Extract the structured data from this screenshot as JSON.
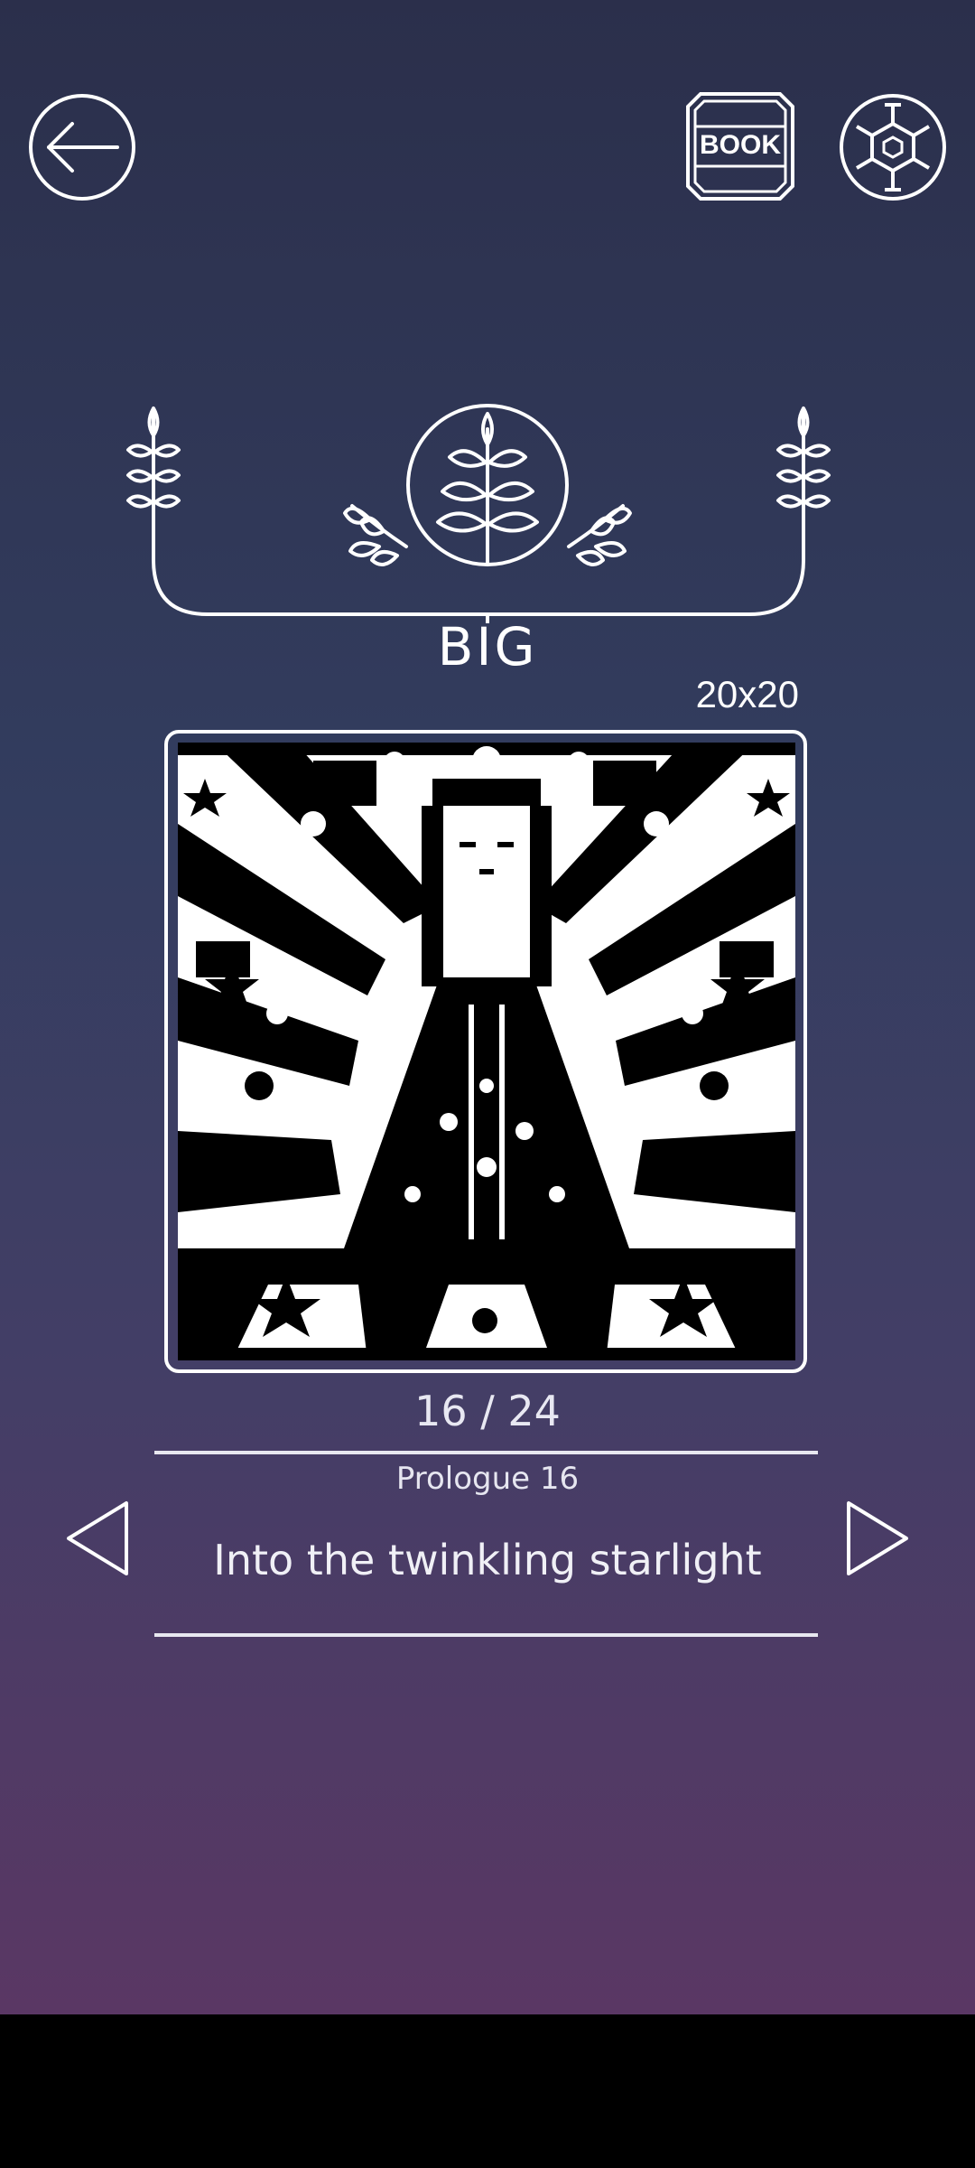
{
  "header": {
    "back_icon": "arrow-left-icon",
    "book_label": "BOOK",
    "settings_icon": "hexagon-gear-icon"
  },
  "level": {
    "title": "BIG",
    "grid_size": "20x20"
  },
  "puzzle": {
    "progress": "16 / 24",
    "chapter": "Prologue 16",
    "name": "Into the twinkling starlight"
  },
  "colors": {
    "bg_top": "#2b2f4b",
    "bg_bottom": "#5a3764",
    "line": "#ffffff"
  }
}
